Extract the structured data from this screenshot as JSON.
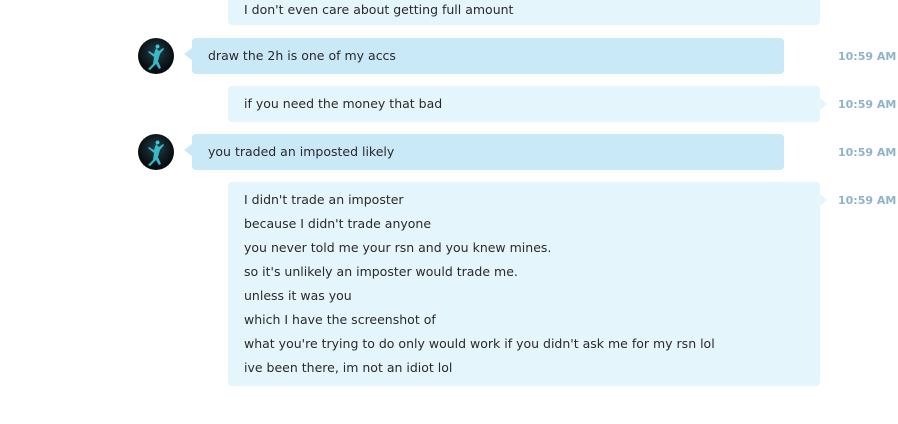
{
  "messages": [
    {
      "id": "m0",
      "direction": "out",
      "lines": [
        "I don't even care about getting full amount"
      ],
      "time": ""
    },
    {
      "id": "m1",
      "direction": "in",
      "lines": [
        "draw the 2h is one of my accs"
      ],
      "time": "10:59 AM"
    },
    {
      "id": "m2",
      "direction": "out",
      "lines": [
        "if you need the money that bad"
      ],
      "time": "10:59 AM"
    },
    {
      "id": "m3",
      "direction": "in",
      "lines": [
        "you traded an imposted likely"
      ],
      "time": "10:59 AM"
    },
    {
      "id": "m4",
      "direction": "out",
      "lines": [
        "I didn't trade an imposter",
        "because I didn't trade anyone",
        "you never told me your rsn and you knew mines.",
        "so it's unlikely an imposter would trade me.",
        "unless it was you",
        "which I have the screenshot of",
        "what you're trying to do only would work if you didn't ask me for my rsn lol",
        "ive been there, im not an idiot lol"
      ],
      "time": "10:59 AM"
    }
  ],
  "colors": {
    "incoming_bubble": "#c9e9f8",
    "outgoing_bubble": "#e5f5fc",
    "timestamp": "#8fb3c7",
    "avatar_glow": "#3fc8d8"
  },
  "icons": {
    "avatar": "jumpman-logo-avatar-icon"
  }
}
